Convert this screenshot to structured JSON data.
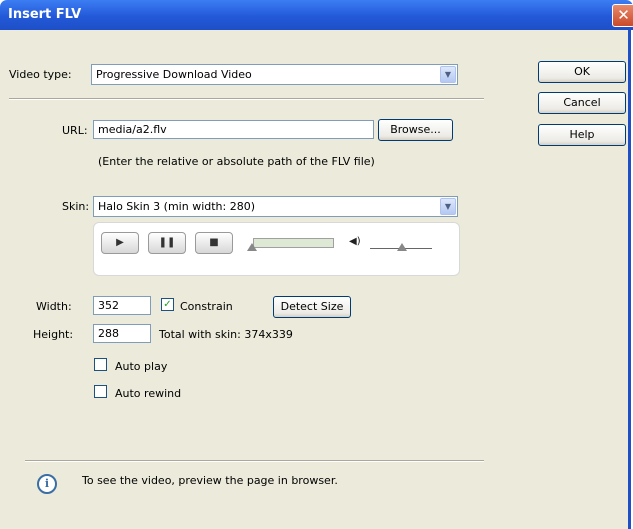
{
  "window": {
    "title": "Insert FLV",
    "close_glyph": "✕"
  },
  "video_type": {
    "label": "Video type:",
    "value": "Progressive Download Video"
  },
  "side_buttons": {
    "ok": "OK",
    "cancel": "Cancel",
    "help": "Help"
  },
  "url": {
    "label": "URL:",
    "value": "media/a2.flv",
    "browse": "Browse...",
    "hint": "(Enter the relative or absolute path of the FLV file)"
  },
  "skin": {
    "label": "Skin:",
    "value": "Halo Skin 3 (min width: 280)"
  },
  "preview_controls": {
    "play": "▶",
    "pause": "❚❚",
    "stop": "■",
    "volume": "◀)"
  },
  "size": {
    "width_label": "Width:",
    "width_value": "352",
    "constrain_label": "Constrain",
    "constrain_checked": true,
    "detect_size": "Detect Size",
    "height_label": "Height:",
    "height_value": "288",
    "total_with_skin": "Total with skin: 374x339"
  },
  "options": {
    "auto_play": "Auto play",
    "auto_rewind": "Auto rewind"
  },
  "footer": {
    "info_glyph": "i",
    "message": "To see the video, preview the page in browser."
  }
}
